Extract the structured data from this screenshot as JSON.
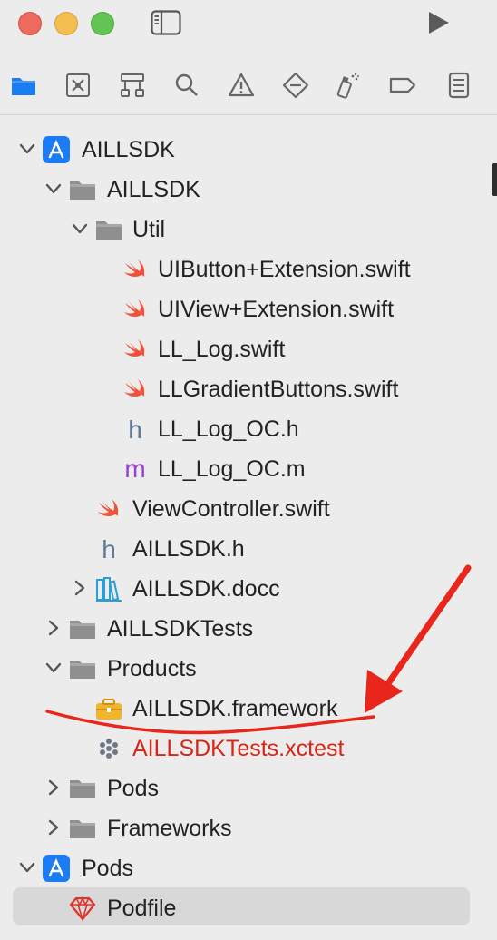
{
  "toolbar": {
    "icons": [
      "close-icon",
      "minimize-icon",
      "zoom-icon",
      "sidebar-toggle-icon",
      "run-icon"
    ]
  },
  "navigator_tabs": [
    "project-navigator-icon",
    "source-control-icon",
    "symbol-navigator-icon",
    "find-icon",
    "issue-icon",
    "test-icon",
    "debug-icon",
    "breakpoint-icon",
    "report-icon"
  ],
  "tree": [
    {
      "label": "AILLSDK",
      "type": "project",
      "expanded": true
    },
    {
      "label": "AILLSDK",
      "type": "folder",
      "expanded": true
    },
    {
      "label": "Util",
      "type": "folder",
      "expanded": true
    },
    {
      "label": "UIButton+Extension.swift",
      "type": "swift"
    },
    {
      "label": "UIView+Extension.swift",
      "type": "swift"
    },
    {
      "label": "LL_Log.swift",
      "type": "swift"
    },
    {
      "label": "LLGradientButtons.swift",
      "type": "swift"
    },
    {
      "label": "LL_Log_OC.h",
      "type": "h"
    },
    {
      "label": "LL_Log_OC.m",
      "type": "m"
    },
    {
      "label": "ViewController.swift",
      "type": "swift"
    },
    {
      "label": "AILLSDK.h",
      "type": "h"
    },
    {
      "label": "AILLSDK.docc",
      "type": "docc",
      "expanded": false
    },
    {
      "label": "AILLSDKTests",
      "type": "folder",
      "expanded": false
    },
    {
      "label": "Products",
      "type": "folder",
      "expanded": true
    },
    {
      "label": "AILLSDK.framework",
      "type": "framework"
    },
    {
      "label": "AILLSDKTests.xctest",
      "type": "xctest",
      "missing": true
    },
    {
      "label": "Pods",
      "type": "folder",
      "expanded": false
    },
    {
      "label": "Frameworks",
      "type": "folder",
      "expanded": false
    },
    {
      "label": "Pods",
      "type": "project",
      "expanded": true
    },
    {
      "label": "Podfile",
      "type": "podfile",
      "selected": true
    }
  ],
  "colors": {
    "swift": "#f05138",
    "h_icon": "#5f7a99",
    "m_icon": "#9b3fd1",
    "folder": "#8f8f8f",
    "project": "#1c7cf4",
    "annotation": "#e8261b",
    "missing_text": "#d6261a"
  }
}
